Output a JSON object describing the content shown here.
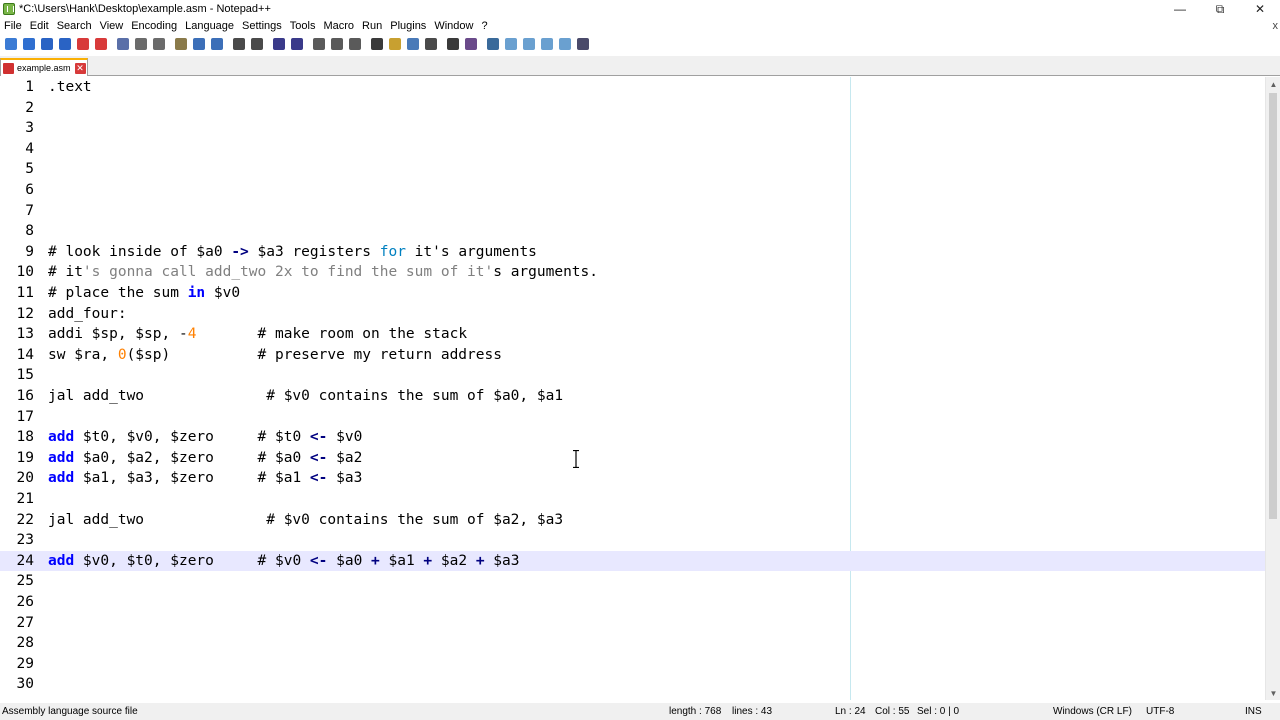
{
  "window": {
    "title": "*C:\\Users\\Hank\\Desktop\\example.asm - Notepad++",
    "controls": [
      "minimize-icon",
      "restore-icon",
      "close-icon"
    ]
  },
  "menu": {
    "items": [
      "File",
      "Edit",
      "Search",
      "View",
      "Encoding",
      "Language",
      "Settings",
      "Tools",
      "Macro",
      "Run",
      "Plugins",
      "Window",
      "?"
    ],
    "close_glyph": "x"
  },
  "toolbar": {
    "buttons": [
      {
        "name": "new-file-icon",
        "color": "#3b7bd4"
      },
      {
        "name": "open-file-icon",
        "color": "#2f6fd0"
      },
      {
        "name": "save-icon",
        "color": "#2a63c4"
      },
      {
        "name": "save-all-icon",
        "color": "#2a63c4"
      },
      {
        "name": "close-icon",
        "color": "#d83a3a"
      },
      {
        "name": "close-all-icon",
        "color": "#d83a3a"
      },
      {
        "name": "print-icon",
        "color": "#5a6fa8"
      },
      {
        "name": "cut-icon",
        "color": "#6b6b6b"
      },
      {
        "name": "copy-icon",
        "color": "#6b6b6b"
      },
      {
        "name": "paste-icon",
        "color": "#8a7a4a"
      },
      {
        "name": "undo-icon",
        "color": "#3c6fb8"
      },
      {
        "name": "redo-icon",
        "color": "#3c6fb8"
      },
      {
        "name": "find-icon",
        "color": "#4a4a4a"
      },
      {
        "name": "replace-icon",
        "color": "#4a4a4a"
      },
      {
        "name": "zoom-in-icon",
        "color": "#3a3a8a"
      },
      {
        "name": "zoom-out-icon",
        "color": "#3a3a8a"
      },
      {
        "name": "sync-vertical-icon",
        "color": "#5a5a5a"
      },
      {
        "name": "sync-horizontal-icon",
        "color": "#5a5a5a"
      },
      {
        "name": "word-wrap-icon",
        "color": "#5a5a5a"
      },
      {
        "name": "show-all-chars-icon",
        "color": "#3a3a3a"
      },
      {
        "name": "indent-guide-icon",
        "color": "#c8a030"
      },
      {
        "name": "udl-icon",
        "color": "#4a7ab8"
      },
      {
        "name": "doc-map-icon",
        "color": "#4a4a4a"
      },
      {
        "name": "function-list-icon",
        "color": "#3a3a3a"
      },
      {
        "name": "folder-workspace-icon",
        "color": "#6a4a8a"
      },
      {
        "name": "monitoring-icon",
        "color": "#3a6a9a"
      },
      {
        "name": "record-macro-icon",
        "color": "#6aa0d0"
      },
      {
        "name": "stop-macro-icon",
        "color": "#6aa0d0"
      },
      {
        "name": "play-macro-icon",
        "color": "#6aa0d0"
      },
      {
        "name": "run-macro-multiple-icon",
        "color": "#6aa0d0"
      },
      {
        "name": "save-macro-icon",
        "color": "#4a4a6a"
      }
    ]
  },
  "tab": {
    "label": "example.asm"
  },
  "editor": {
    "lines": [
      {
        "n": "1",
        "segments": [
          [
            "",
            ".text"
          ]
        ]
      },
      {
        "n": "2",
        "segments": []
      },
      {
        "n": "3",
        "segments": []
      },
      {
        "n": "4",
        "segments": []
      },
      {
        "n": "5",
        "segments": []
      },
      {
        "n": "6",
        "segments": []
      },
      {
        "n": "7",
        "segments": []
      },
      {
        "n": "8",
        "segments": []
      },
      {
        "n": "9",
        "segments": [
          [
            "",
            "# look inside of $a0 "
          ],
          [
            "op",
            "->"
          ],
          [
            "",
            " $a3 registers "
          ],
          [
            "kw2",
            "for"
          ],
          [
            "",
            " it's arguments"
          ]
        ]
      },
      {
        "n": "10",
        "segments": [
          [
            "",
            "# it"
          ],
          [
            "str",
            "'s gonna call add_two 2x to find the sum of it'"
          ],
          [
            "",
            "s arguments."
          ]
        ]
      },
      {
        "n": "11",
        "segments": [
          [
            "",
            "# place the sum "
          ],
          [
            "kw",
            "in"
          ],
          [
            "",
            " $v0"
          ]
        ]
      },
      {
        "n": "12",
        "segments": [
          [
            "",
            "add_four:"
          ]
        ]
      },
      {
        "n": "13",
        "segments": [
          [
            "",
            "addi $sp, $sp, -"
          ],
          [
            "num",
            "4"
          ],
          [
            "",
            "       # make room on the stack"
          ]
        ]
      },
      {
        "n": "14",
        "segments": [
          [
            "",
            "sw $ra, "
          ],
          [
            "num",
            "0"
          ],
          [
            "",
            "($sp)          # preserve my return address"
          ]
        ]
      },
      {
        "n": "15",
        "segments": []
      },
      {
        "n": "16",
        "segments": [
          [
            "",
            "jal add_two              # $v0 contains the sum of $a0, $a1"
          ]
        ]
      },
      {
        "n": "17",
        "segments": []
      },
      {
        "n": "18",
        "segments": [
          [
            "kw",
            "add"
          ],
          [
            "",
            " $t0, $v0, $zero     # $t0 "
          ],
          [
            "op",
            "<-"
          ],
          [
            "",
            " $v0"
          ]
        ]
      },
      {
        "n": "19",
        "segments": [
          [
            "kw",
            "add"
          ],
          [
            "",
            " $a0, $a2, $zero     # $a0 "
          ],
          [
            "op",
            "<-"
          ],
          [
            "",
            " $a2"
          ]
        ]
      },
      {
        "n": "20",
        "segments": [
          [
            "kw",
            "add"
          ],
          [
            "",
            " $a1, $a3, $zero     # $a1 "
          ],
          [
            "op",
            "<-"
          ],
          [
            "",
            " $a3"
          ]
        ]
      },
      {
        "n": "21",
        "segments": []
      },
      {
        "n": "22",
        "segments": [
          [
            "",
            "jal add_two              # $v0 contains the sum of $a2, $a3"
          ]
        ]
      },
      {
        "n": "23",
        "segments": []
      },
      {
        "n": "24",
        "current": true,
        "segments": [
          [
            "kw",
            "add"
          ],
          [
            "",
            " $v0, $t0, $zero     # $v0 "
          ],
          [
            "op",
            "<-"
          ],
          [
            "",
            " $a0 "
          ],
          [
            "op",
            "+"
          ],
          [
            "",
            " $a1 "
          ],
          [
            "op",
            "+"
          ],
          [
            "",
            " $a2 "
          ],
          [
            "op",
            "+"
          ],
          [
            "",
            " $a3"
          ]
        ]
      },
      {
        "n": "25",
        "segments": []
      },
      {
        "n": "26",
        "segments": []
      },
      {
        "n": "27",
        "segments": []
      },
      {
        "n": "28",
        "segments": []
      },
      {
        "n": "29",
        "segments": []
      },
      {
        "n": "30",
        "segments": []
      }
    ]
  },
  "status": {
    "file_type": "Assembly language source file",
    "length": "length : 768",
    "lines": "lines : 43",
    "ln": "Ln : 24",
    "col": "Col : 55",
    "sel": "Sel : 0 | 0",
    "eol": "Windows (CR LF)",
    "encoding": "UTF-8",
    "ins": "INS"
  }
}
